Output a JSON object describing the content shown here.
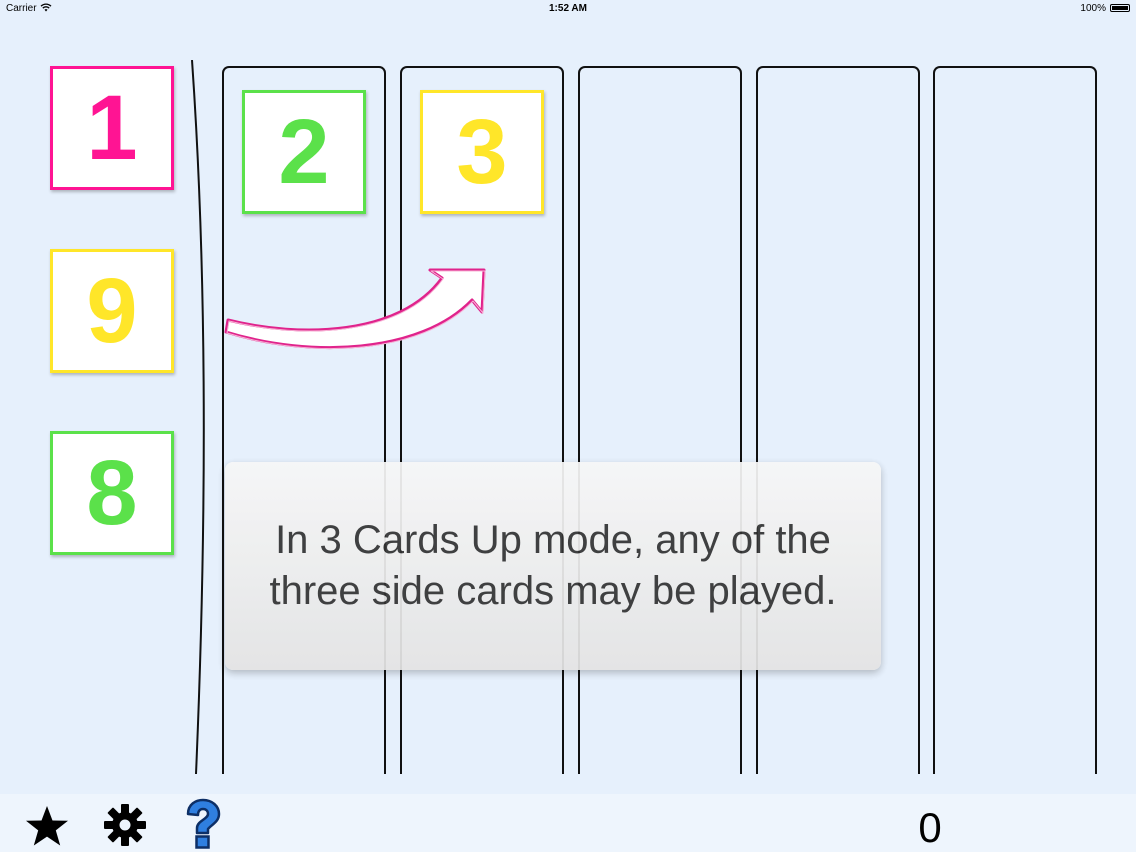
{
  "status_bar": {
    "carrier": "Carrier",
    "time": "1:52 AM",
    "battery": "100%"
  },
  "side_cards": [
    {
      "value": "1",
      "color": "#ff1493"
    },
    {
      "value": "9",
      "color": "#ffe629"
    },
    {
      "value": "8",
      "color": "#5be14a"
    }
  ],
  "column_cards": [
    {
      "value": "2",
      "color": "#5be14a"
    },
    {
      "value": "3",
      "color": "#ffe629"
    }
  ],
  "colors": {
    "background": "#e6f0fc",
    "arrow_outline": "#e0238c"
  },
  "tooltip": {
    "text": "In 3 Cards Up mode, any of the three side cards may be played."
  },
  "toolbar": {
    "star_icon": "star-icon",
    "settings_icon": "gear-icon",
    "help_icon": "help-icon"
  },
  "score": "0"
}
